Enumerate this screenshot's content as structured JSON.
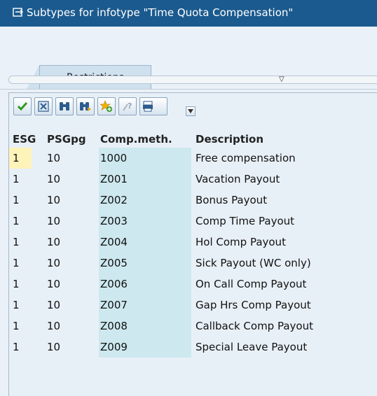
{
  "window": {
    "title": "Subtypes for infotype \"Time Quota Compensation\""
  },
  "tabs": [
    {
      "label": "Restrictions"
    }
  ],
  "toolbar": {
    "buttons": [
      {
        "icon": "checkmark-icon"
      },
      {
        "icon": "cancel-icon"
      },
      {
        "icon": "find-icon"
      },
      {
        "icon": "find-next-icon"
      },
      {
        "icon": "new-entry-icon"
      },
      {
        "icon": "help-icon"
      },
      {
        "icon": "print-icon"
      }
    ]
  },
  "table": {
    "columns": [
      "ESG",
      "PSGpg",
      "Comp.meth.",
      "Description"
    ],
    "rows": [
      {
        "esg": "1",
        "psgpg": "10",
        "comp": "1000",
        "desc": "Free compensation"
      },
      {
        "esg": "1",
        "psgpg": "10",
        "comp": "Z001",
        "desc": "Vacation Payout"
      },
      {
        "esg": "1",
        "psgpg": "10",
        "comp": "Z002",
        "desc": "Bonus Payout"
      },
      {
        "esg": "1",
        "psgpg": "10",
        "comp": "Z003",
        "desc": "Comp Time Payout"
      },
      {
        "esg": "1",
        "psgpg": "10",
        "comp": "Z004",
        "desc": "Hol Comp Payout"
      },
      {
        "esg": "1",
        "psgpg": "10",
        "comp": "Z005",
        "desc": "Sick Payout (WC only)"
      },
      {
        "esg": "1",
        "psgpg": "10",
        "comp": "Z006",
        "desc": "On Call Comp Payout"
      },
      {
        "esg": "1",
        "psgpg": "10",
        "comp": "Z007",
        "desc": "Gap Hrs Comp Payout"
      },
      {
        "esg": "1",
        "psgpg": "10",
        "comp": "Z008",
        "desc": "Callback Comp Payout"
      },
      {
        "esg": "1",
        "psgpg": "10",
        "comp": "Z009",
        "desc": "Special Leave Payout"
      }
    ]
  },
  "colors": {
    "title_bar": "#1b5a8e",
    "comp_column": "#cde8ef",
    "selected_cell": "#fef3b9"
  }
}
